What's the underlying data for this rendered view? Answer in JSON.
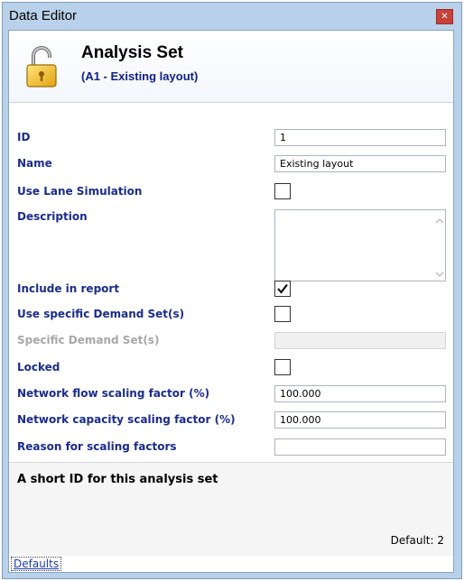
{
  "window": {
    "title": "Data Editor"
  },
  "header": {
    "title": "Analysis Set",
    "subtitle": "(A1 - Existing layout)"
  },
  "fields": {
    "id": {
      "label": "ID",
      "value": "1"
    },
    "name": {
      "label": "Name",
      "value": "Existing layout"
    },
    "use_lane_simulation": {
      "label": "Use Lane Simulation",
      "checked": false
    },
    "description": {
      "label": "Description",
      "value": ""
    },
    "include_in_report": {
      "label": "Include in report",
      "checked": true
    },
    "use_specific_demand_sets": {
      "label": "Use specific Demand Set(s)",
      "checked": false
    },
    "specific_demand_sets": {
      "label": "Specific Demand Set(s)",
      "value": "",
      "disabled": true
    },
    "locked": {
      "label": "Locked",
      "checked": false
    },
    "network_flow_scaling": {
      "label": "Network flow scaling factor (%)",
      "value": "100.000"
    },
    "network_capacity_scaling": {
      "label": "Network capacity scaling factor (%)",
      "value": "100.000"
    },
    "reason_for_scaling": {
      "label": "Reason for scaling factors",
      "value": ""
    }
  },
  "help": {
    "text": "A short ID for this analysis set",
    "default": "Default: 2"
  },
  "footer": {
    "defaults_link": "Defaults"
  },
  "icons": {
    "header": "lock-open-icon",
    "close": "close-icon"
  },
  "colors": {
    "label_blue": "#1a2c8c",
    "close_red": "#c7413a",
    "frame": "#b9d1ea"
  }
}
